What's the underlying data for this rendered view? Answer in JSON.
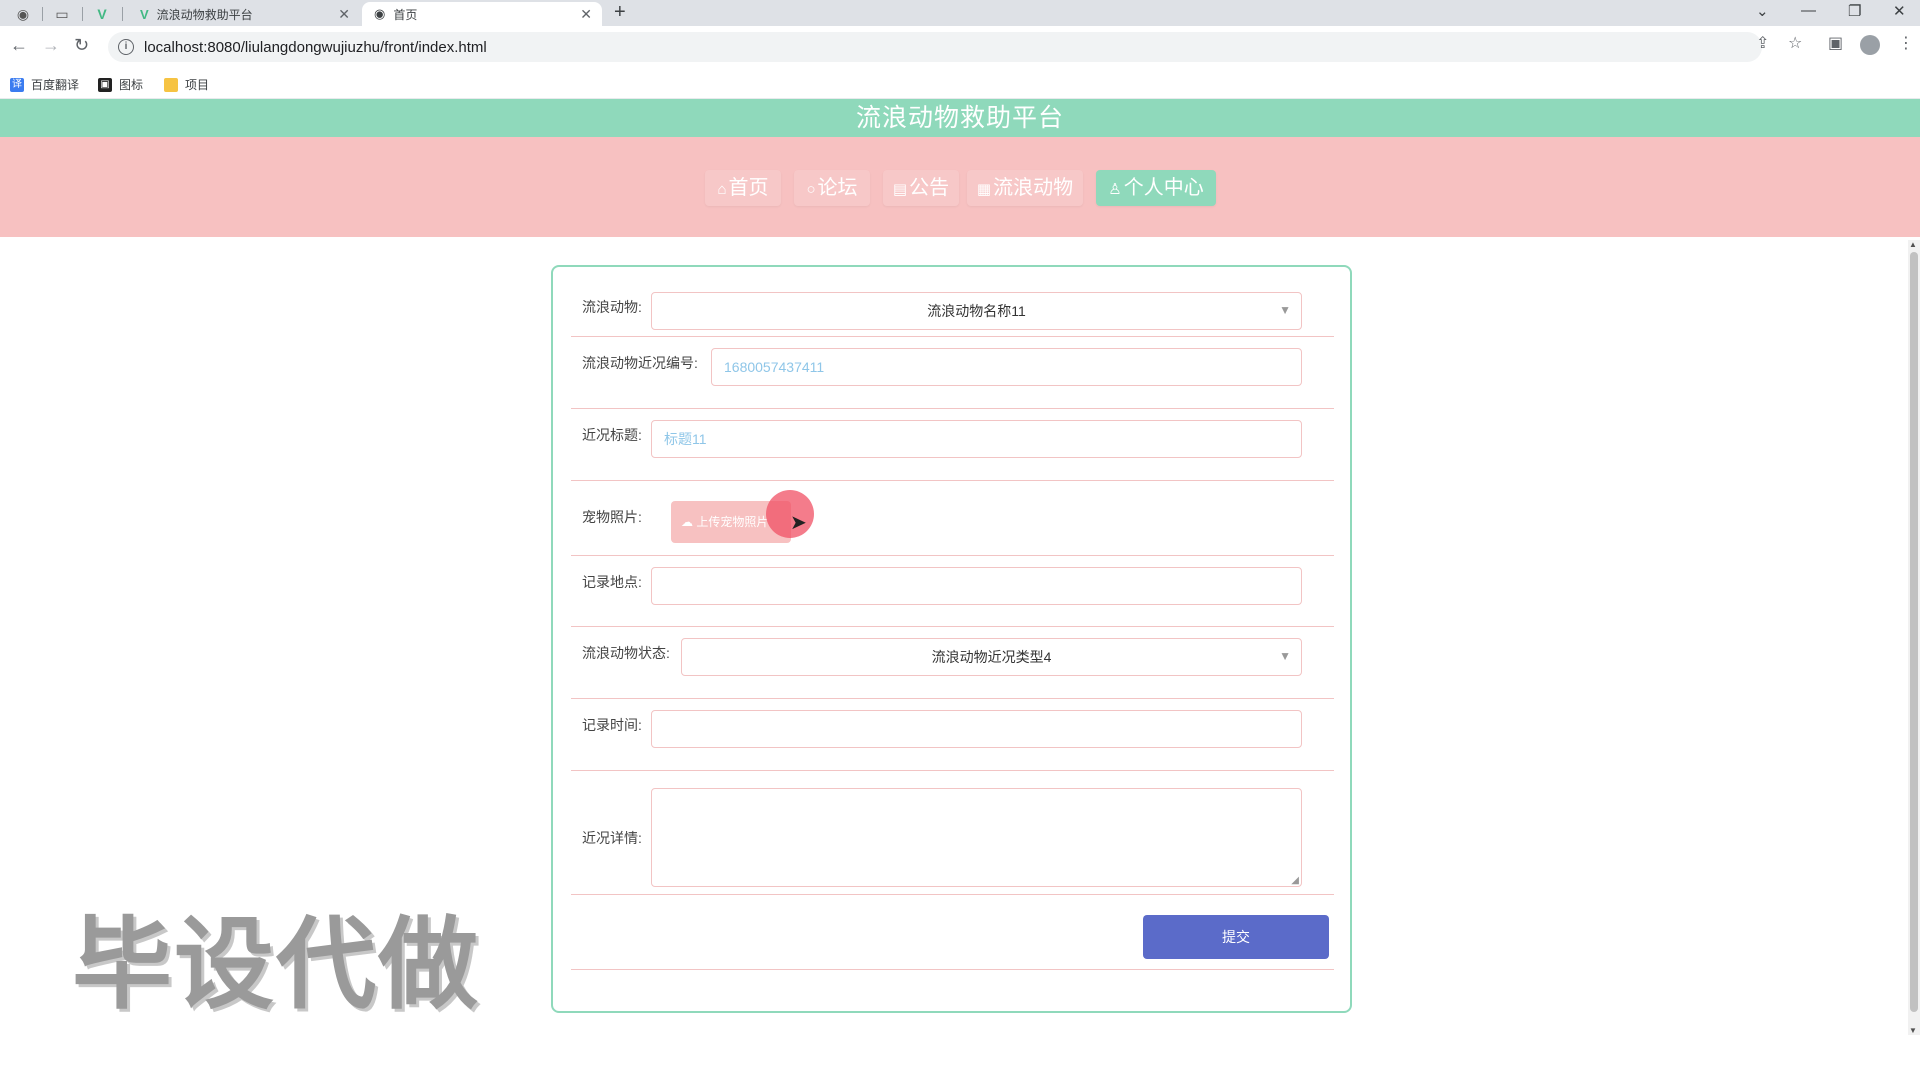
{
  "browser": {
    "tabs": [
      {
        "title": "流浪动物救助平台",
        "icon": "vue-icon"
      },
      {
        "title": "首页",
        "icon": "globe-icon",
        "active": true
      }
    ],
    "url": "localhost:8080/liulangdongwujiuzhu/front/index.html",
    "bookmarks": [
      "百度翻译",
      "图标",
      "项目"
    ]
  },
  "site": {
    "title": "流浪动物救助平台",
    "nav": [
      {
        "icon": "⌂",
        "label": "首页"
      },
      {
        "icon": "○",
        "label": "论坛"
      },
      {
        "icon": "▤",
        "label": "公告"
      },
      {
        "icon": "▦",
        "label": "流浪动物"
      },
      {
        "icon": "♙",
        "label": "个人中心",
        "active": true
      }
    ]
  },
  "form": {
    "animal_label": "流浪动物:",
    "animal_value": "流浪动物名称11",
    "code_label": "流浪动物近况编号:",
    "code_value": "1680057437411",
    "title_label": "近况标题:",
    "title_value": "标题11",
    "photo_label": "宠物照片:",
    "photo_button": "上传宠物照片",
    "place_label": "记录地点:",
    "place_value": "",
    "status_label": "流浪动物状态:",
    "status_value": "流浪动物近况类型4",
    "time_label": "记录时间:",
    "time_value": "",
    "detail_label": "近况详情:",
    "submit_label": "提交"
  },
  "watermark": "毕设代做",
  "colors": {
    "mint": "#8fd9bb",
    "pink": "#f7c1c1",
    "submit": "#5b6bc9"
  }
}
